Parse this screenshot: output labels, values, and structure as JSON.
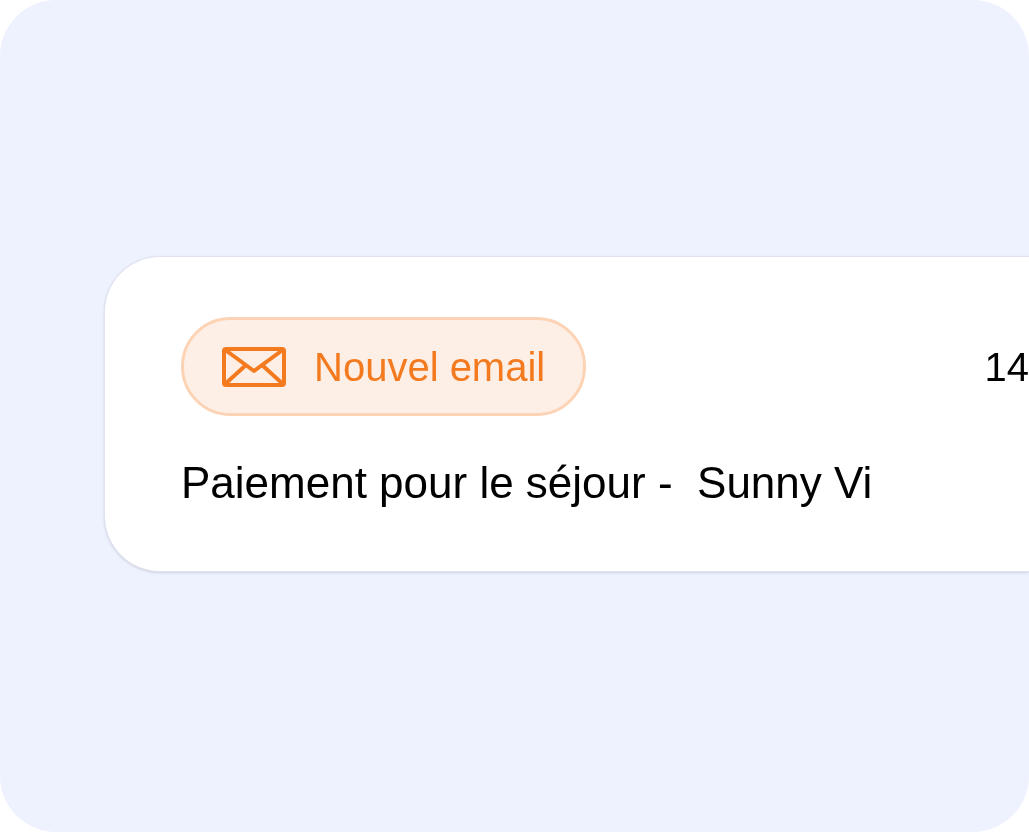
{
  "notification": {
    "badge": {
      "label": "Nouvel email"
    },
    "time": "14",
    "subject": "Paiement pour le séjour -  Sunny Vi"
  }
}
